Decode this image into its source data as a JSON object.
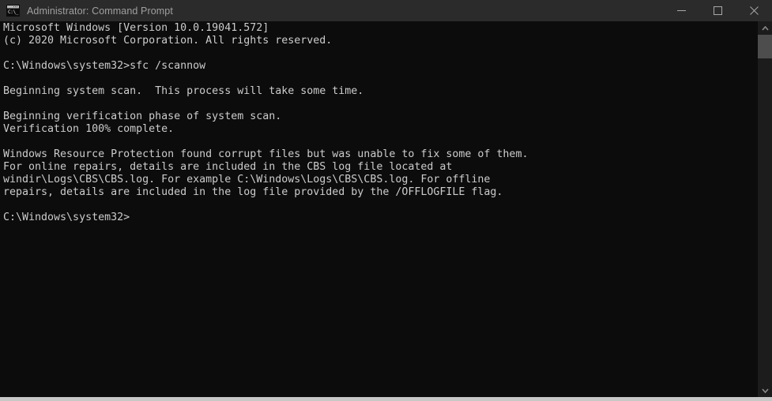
{
  "window": {
    "title": "Administrator: Command Prompt",
    "icon_name": "command-prompt-icon",
    "icon_glyph": "C:\\_",
    "background_color": "#0c0c0c",
    "titlebar_color": "#2b2b2b",
    "text_color": "#cccccc"
  },
  "controls": {
    "minimize_label": "Minimize",
    "maximize_label": "Maximize",
    "close_label": "Close"
  },
  "console": {
    "text": "Microsoft Windows [Version 10.0.19041.572]\n(c) 2020 Microsoft Corporation. All rights reserved.\n\nC:\\Windows\\system32>sfc /scannow\n\nBeginning system scan.  This process will take some time.\n\nBeginning verification phase of system scan.\nVerification 100% complete.\n\nWindows Resource Protection found corrupt files but was unable to fix some of them.\nFor online repairs, details are included in the CBS log file located at\nwindir\\Logs\\CBS\\CBS.log. For example C:\\Windows\\Logs\\CBS\\CBS.log. For offline\nrepairs, details are included in the log file provided by the /OFFLOGFILE flag.\n\nC:\\Windows\\system32>",
    "lines": [
      "Microsoft Windows [Version 10.0.19041.572]",
      "(c) 2020 Microsoft Corporation. All rights reserved.",
      "",
      "C:\\Windows\\system32>sfc /scannow",
      "",
      "Beginning system scan.  This process will take some time.",
      "",
      "Beginning verification phase of system scan.",
      "Verification 100% complete.",
      "",
      "Windows Resource Protection found corrupt files but was unable to fix some of them.",
      "For online repairs, details are included in the CBS log file located at",
      "windir\\Logs\\CBS\\CBS.log. For example C:\\Windows\\Logs\\CBS\\CBS.log. For offline",
      "repairs, details are included in the log file provided by the /OFFLOGFILE flag.",
      "",
      "C:\\Windows\\system32>"
    ],
    "command_entered": "sfc /scannow",
    "prompt": "C:\\Windows\\system32>",
    "verification_progress": "100%"
  },
  "scrollbar": {
    "up_arrow_label": "Scroll up",
    "down_arrow_label": "Scroll down",
    "thumb_color": "#4d4d4d",
    "track_color": "#1c1c1c"
  }
}
